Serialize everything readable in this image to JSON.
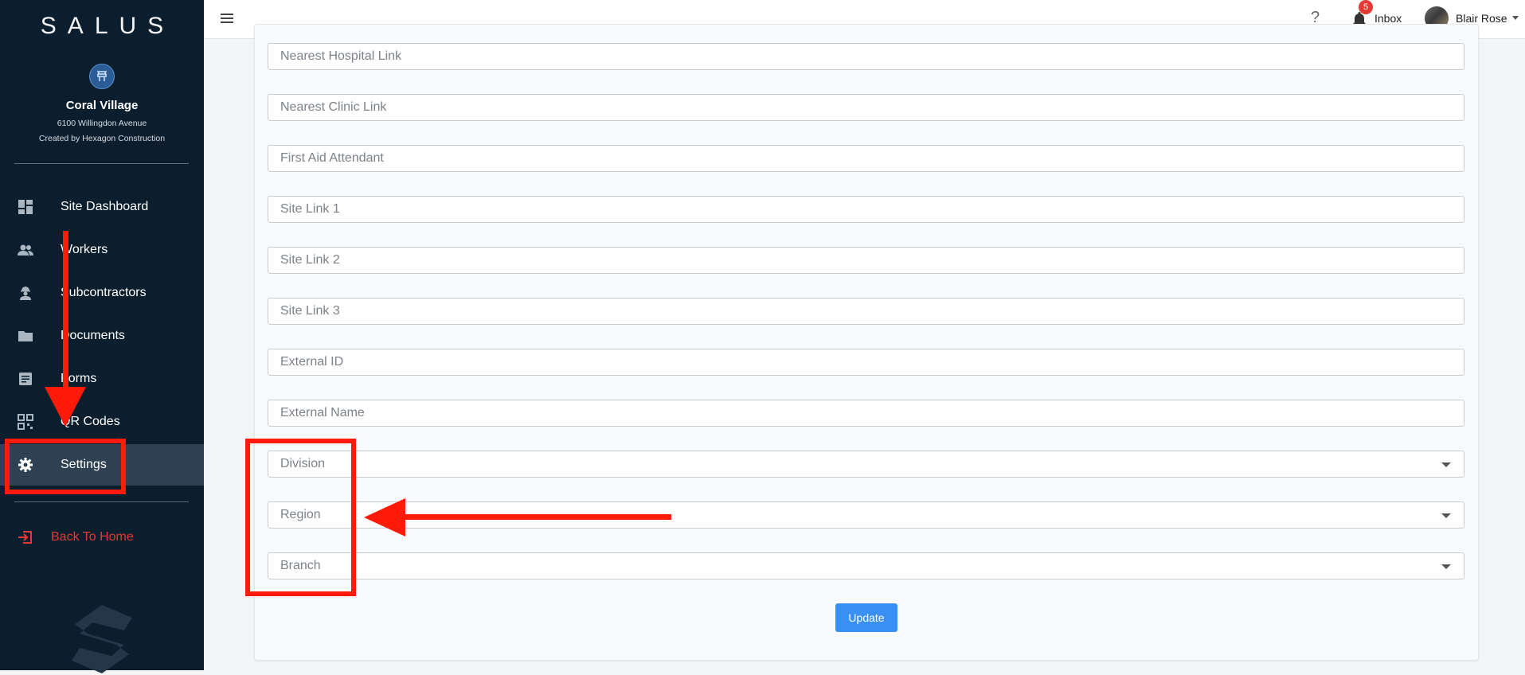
{
  "app": {
    "logo": "SALUS"
  },
  "site": {
    "name": "Coral Village",
    "address": "6100 Willingdon Avenue",
    "creator": "Created by Hexagon Construction"
  },
  "nav": {
    "items": [
      {
        "label": "Site Dashboard",
        "icon": "dashboard-icon"
      },
      {
        "label": "Workers",
        "icon": "people-icon"
      },
      {
        "label": "Subcontractors",
        "icon": "worker-icon"
      },
      {
        "label": "Documents",
        "icon": "folder-icon"
      },
      {
        "label": "Forms",
        "icon": "form-icon"
      },
      {
        "label": "QR Codes",
        "icon": "qr-code-icon"
      },
      {
        "label": "Settings",
        "icon": "gear-icon",
        "active": true
      }
    ],
    "back_home": "Back To Home"
  },
  "topbar": {
    "help": "?",
    "notifications_count": "5",
    "inbox_label": "Inbox",
    "user_name": "Blair Rose"
  },
  "form": {
    "fields": [
      {
        "placeholder": "Nearest Hospital Link"
      },
      {
        "placeholder": "Nearest Clinic Link"
      },
      {
        "placeholder": "First Aid Attendant"
      },
      {
        "placeholder": "Site Link 1"
      },
      {
        "placeholder": "Site Link 2"
      },
      {
        "placeholder": "Site Link 3"
      },
      {
        "placeholder": "External ID"
      },
      {
        "placeholder": "External Name"
      }
    ],
    "selects": [
      {
        "label": "Division"
      },
      {
        "label": "Region"
      },
      {
        "label": "Branch"
      }
    ],
    "update_label": "Update"
  },
  "colors": {
    "sidebar_bg": "#0b1e2d",
    "accent": "#3a8ff5",
    "annotation": "#ff1a0a",
    "back_home": "#e53935"
  }
}
